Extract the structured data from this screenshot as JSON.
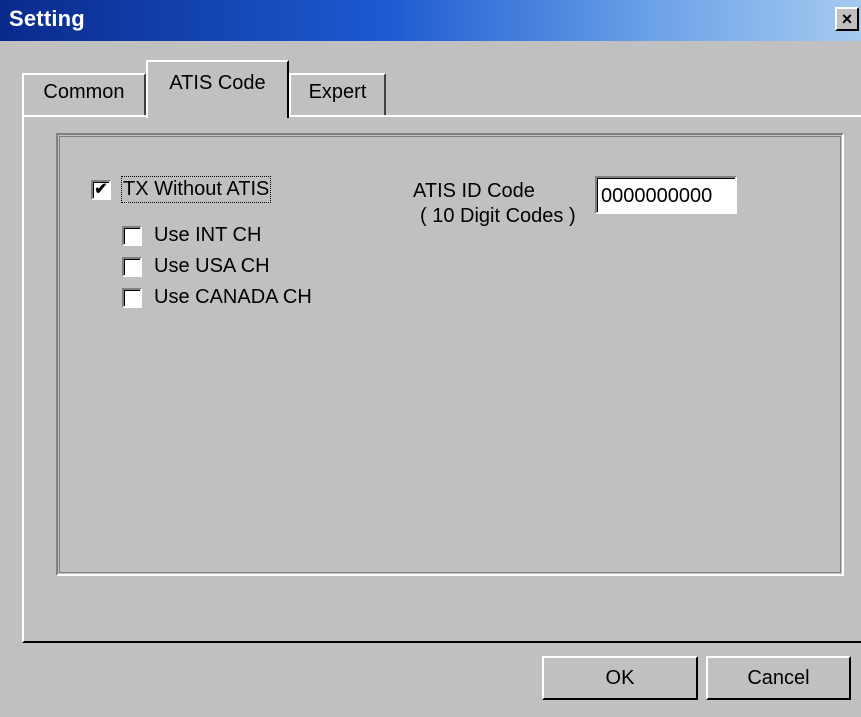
{
  "window": {
    "title": "Setting",
    "close_glyph": "×"
  },
  "tabs": [
    {
      "label": "Common"
    },
    {
      "label": "ATIS Code",
      "selected": true
    },
    {
      "label": "Expert"
    }
  ],
  "options": {
    "tx_without_atis": {
      "label": "TX Without ATIS",
      "checked": true
    },
    "use_int_ch": {
      "label": "Use INT CH",
      "checked": false
    },
    "use_usa_ch": {
      "label": "Use USA CH",
      "checked": false
    },
    "use_canada_ch": {
      "label": "Use CANADA CH",
      "checked": false
    }
  },
  "atis": {
    "label": "ATIS ID Code",
    "sublabel": "( 10 Digit Codes )",
    "value": "0000000000"
  },
  "buttons": {
    "ok": "OK",
    "cancel": "Cancel"
  },
  "check_glyph": "✔"
}
